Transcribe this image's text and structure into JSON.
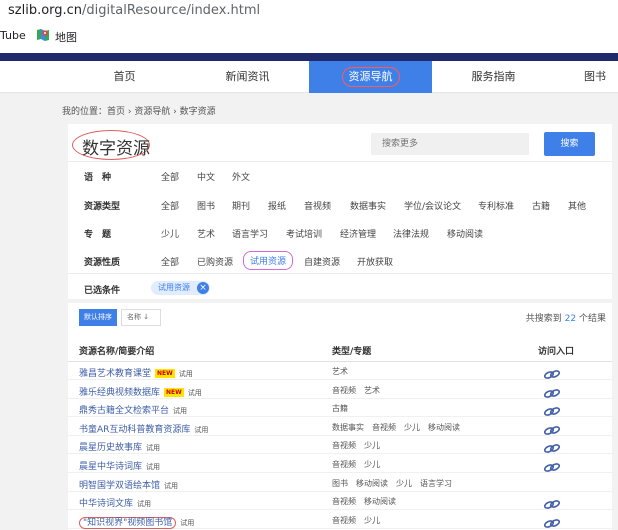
{
  "browser": {
    "url_domain": "szlib.org.cn",
    "url_path": "/digitalResource/index.html",
    "bookmarks": [
      {
        "label": "Tube"
      },
      {
        "label": "地图",
        "icon": "maps-icon"
      }
    ]
  },
  "nav": {
    "items": [
      {
        "label": "首页"
      },
      {
        "label": "新闻资讯"
      },
      {
        "label": "资源导航",
        "active": true
      },
      {
        "label": "服务指南"
      },
      {
        "label": "图书"
      }
    ]
  },
  "breadcrumb": "我的位置：首页 › 资源导航 › 数字资源",
  "header": {
    "title": "数字资源",
    "search_placeholder": "搜索更多",
    "search_button": "搜索"
  },
  "filters": [
    {
      "label": "语　种",
      "options": [
        "全部",
        "中文",
        "外文"
      ]
    },
    {
      "label": "资源类型",
      "options": [
        "全部",
        "图书",
        "期刊",
        "报纸",
        "音视频",
        "数据事实",
        "学位/会议论文",
        "专利标准",
        "古籍",
        "其他"
      ]
    },
    {
      "label": "专　题",
      "options": [
        "少儿",
        "艺术",
        "语言学习",
        "考试培训",
        "经济管理",
        "法律法规",
        "移动阅读"
      ]
    },
    {
      "label": "资源性质",
      "options": [
        "全部",
        "已购资源",
        "试用资源",
        "自建资源",
        "开放获取"
      ],
      "selected": "试用资源"
    }
  ],
  "selected_conditions": {
    "label": "已选条件",
    "chips": [
      "试用资源"
    ]
  },
  "sort": {
    "default_label": "默认排序",
    "name_label": "名称 ↓"
  },
  "result_count": {
    "prefix": "共搜索到",
    "value": "22",
    "suffix": "个结果"
  },
  "table": {
    "headers": {
      "name": "资源名称/简要介绍",
      "type": "类型/专题",
      "access": "访问入口"
    },
    "rows": [
      {
        "name": "雅昌艺术教育课堂",
        "new": true,
        "trial": "试用",
        "type": "艺术",
        "access_icon": true
      },
      {
        "name": "雅乐经典视频数据库",
        "new": true,
        "trial": "试用",
        "type": "音视频　艺术",
        "access_icon": true
      },
      {
        "name": "鼎秀古籍全文检索平台",
        "new": false,
        "trial": "试用",
        "type": "古籍",
        "access_icon": true
      },
      {
        "name": "书童AR互动科普教育资源库",
        "new": false,
        "trial": "试用",
        "type": "数据事实　音视频　少儿　移动阅读",
        "access_icon": true
      },
      {
        "name": "晨星历史故事库",
        "new": false,
        "trial": "试用",
        "type": "音视频　少儿",
        "access_icon": true
      },
      {
        "name": "晨星中华诗词库",
        "new": false,
        "trial": "试用",
        "type": "音视频　少儿",
        "access_icon": true
      },
      {
        "name": "明智国学双语绘本馆",
        "new": false,
        "trial": "试用",
        "type": "图书　移动阅读　少儿　语言学习",
        "access_icon": false
      },
      {
        "name": "中华诗词文库",
        "new": false,
        "trial": "试用",
        "type": "音视频　移动阅读",
        "access_icon": true
      },
      {
        "name": "\"知识视界\"视频图书馆",
        "new": false,
        "trial": "试用",
        "type": "音视频　少儿",
        "access_icon": true,
        "circled": true
      }
    ]
  },
  "colors": {
    "accent": "#3f7fe8",
    "nav_band": "#1e2a6b",
    "link": "#3f5fa8",
    "annotation_red": "#e06060"
  }
}
